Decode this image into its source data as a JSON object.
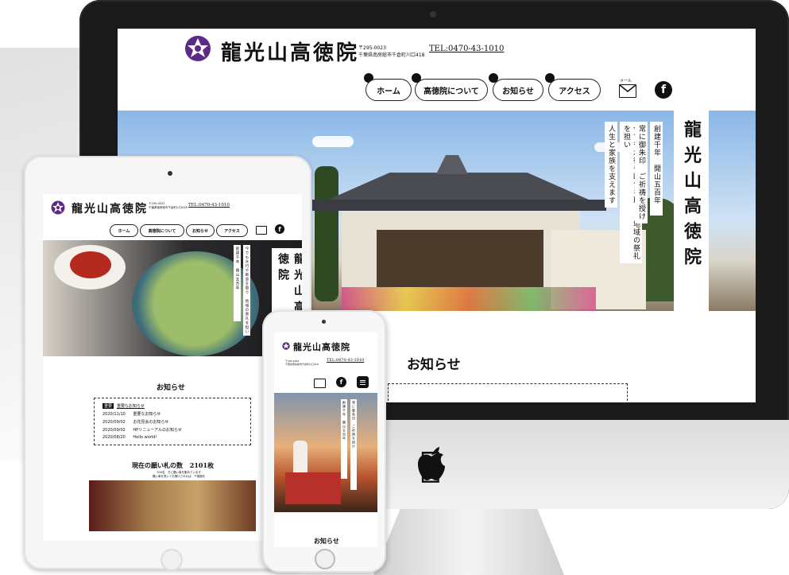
{
  "site": {
    "brand": "龍光山高徳院",
    "address_line1": "〒295-0023",
    "address_line2": "千葉県南房総市千倉町川口418",
    "tel": "TEL:0470-43-1010",
    "mail_label": "メール"
  },
  "nav": {
    "items": [
      {
        "label": "ホーム"
      },
      {
        "label": "高徳院について"
      },
      {
        "label": "お知らせ"
      },
      {
        "label": "アクセス"
      }
    ]
  },
  "hero": {
    "title": "龍光山高徳院",
    "catch_lines": [
      "創建千年　開山五百年",
      "常に御朱印　ご祈祷を授け",
      "今でも水行や断食を取り　地域の祭礼を担い",
      "人生と家族を支えます"
    ]
  },
  "news": {
    "title": "お知らせ",
    "badge": "重要",
    "items": [
      {
        "date": "",
        "title": "重要なお知らせ"
      },
      {
        "date": "2020/11/10",
        "title": "重要なお知らせ"
      },
      {
        "date": "2020/09/02",
        "title": "お花見会のお知らせ"
      },
      {
        "date": "2020/09/02",
        "title": "HPリニューアルのお知らせ"
      },
      {
        "date": "2020/08/20",
        "title": "Hello world!"
      }
    ]
  },
  "wishes": {
    "label": "現在の願い札の数",
    "count": "2101枚",
    "note1": "300名　方に願い事を集めています",
    "note2": "願い事を書いてお預けされれば　千歳館を"
  },
  "colors": {
    "brand_purple": "#5b2a86",
    "text": "#111111"
  },
  "icons": {
    "mail": "mail-icon",
    "facebook": "facebook-icon",
    "menu": "hamburger-menu-icon",
    "logo": "bellflower-crest-icon"
  }
}
